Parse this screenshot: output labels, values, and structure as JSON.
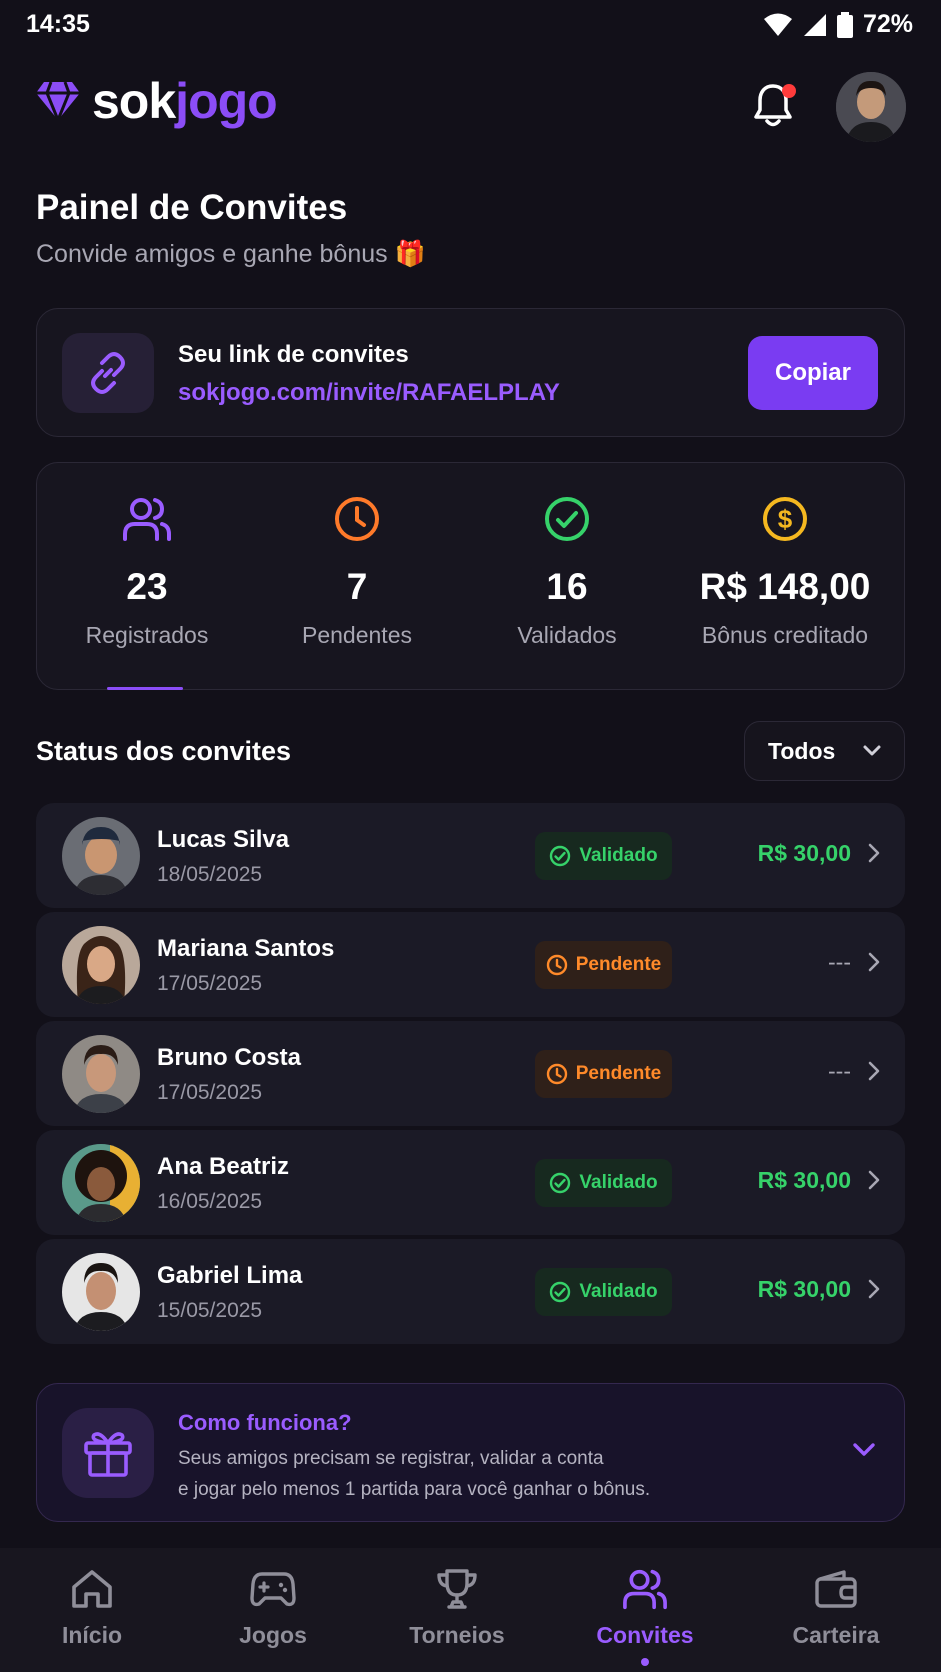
{
  "status_bar": {
    "time": "14:35",
    "battery": "72%"
  },
  "header": {
    "logo_main": "sok",
    "logo_accent": "jogo",
    "notification_dot": true
  },
  "page": {
    "title": "Painel de Convites",
    "subtitle": "Convide amigos e ganhe bônus 🎁"
  },
  "invite": {
    "title": "Seu link de convites",
    "url": "sokjogo.com/invite/RAFAELPLAY",
    "copy_label": "Copiar"
  },
  "stats": [
    {
      "icon": "users-icon",
      "value": "23",
      "label": "Registrados",
      "color": "#9a5cff"
    },
    {
      "icon": "clock-icon",
      "value": "7",
      "label": "Pendentes",
      "color": "#ff7a2a"
    },
    {
      "icon": "check-circle-icon",
      "value": "16",
      "label": "Validados",
      "color": "#36d26a"
    },
    {
      "icon": "dollar-icon",
      "value": "R$ 148,00",
      "label": "Bônus creditado",
      "color": "#f5b820"
    }
  ],
  "status_section": {
    "title": "Status dos convites",
    "filter_value": "Todos"
  },
  "invites": [
    {
      "name": "Lucas Silva",
      "date": "18/05/2025",
      "status": "Validado",
      "status_type": "ok",
      "amount": "R$ 30,00"
    },
    {
      "name": "Mariana Santos",
      "date": "17/05/2025",
      "status": "Pendente",
      "status_type": "pend",
      "amount": "---"
    },
    {
      "name": "Bruno Costa",
      "date": "17/05/2025",
      "status": "Pendente",
      "status_type": "pend",
      "amount": "---"
    },
    {
      "name": "Ana Beatriz",
      "date": "16/05/2025",
      "status": "Validado",
      "status_type": "ok",
      "amount": "R$ 30,00"
    },
    {
      "name": "Gabriel Lima",
      "date": "15/05/2025",
      "status": "Validado",
      "status_type": "ok",
      "amount": "R$ 30,00"
    }
  ],
  "how": {
    "title": "Como funciona?",
    "line1": "Seus amigos precisam se registrar, validar a conta",
    "line2": "e jogar pelo menos 1 partida para você ganhar o bônus."
  },
  "nav": [
    {
      "label": "Início",
      "icon": "home-icon",
      "active": false
    },
    {
      "label": "Jogos",
      "icon": "gamepad-icon",
      "active": false
    },
    {
      "label": "Torneios",
      "icon": "trophy-icon",
      "active": false
    },
    {
      "label": "Convites",
      "icon": "users-icon",
      "active": true
    },
    {
      "label": "Carteira",
      "icon": "wallet-icon",
      "active": false
    }
  ],
  "colors": {
    "accent": "#7a3cf2",
    "success": "#36d26a",
    "pending": "#ff8a2a",
    "background": "#121019"
  }
}
